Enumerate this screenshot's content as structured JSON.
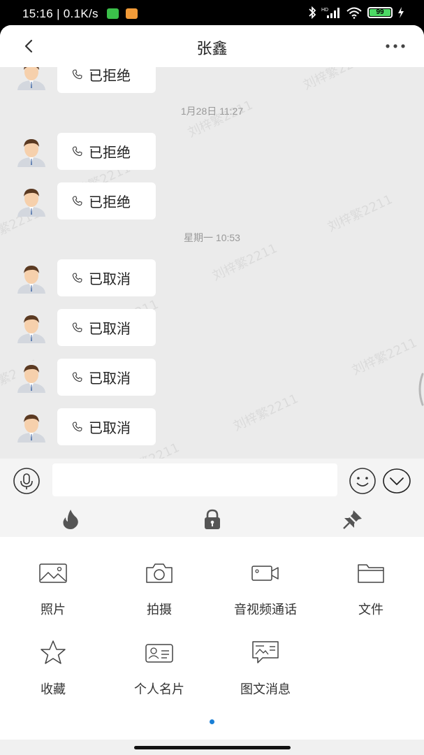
{
  "status_bar": {
    "time_speed": "15:16 | 0.1K/s",
    "battery": "99",
    "network": "HD"
  },
  "header": {
    "title": "张鑫"
  },
  "watermark": "刘梓繁2211",
  "messages": [
    {
      "text": "已拒绝"
    },
    {
      "timestamp": "1月28日 11:27"
    },
    {
      "text": "已拒绝"
    },
    {
      "text": "已拒绝"
    },
    {
      "timestamp": "星期一 10:53"
    },
    {
      "text": "已取消"
    },
    {
      "text": "已取消"
    },
    {
      "text": "已取消"
    },
    {
      "text": "已取消"
    }
  ],
  "input": {
    "value": "",
    "placeholder": ""
  },
  "tools": [
    "flame-icon",
    "lock-icon",
    "pin-off-icon"
  ],
  "panel": {
    "items": [
      {
        "label": "照片",
        "icon": "image-icon"
      },
      {
        "label": "拍摄",
        "icon": "camera-icon"
      },
      {
        "label": "音视频通话",
        "icon": "video-call-icon"
      },
      {
        "label": "文件",
        "icon": "folder-icon"
      },
      {
        "label": "收藏",
        "icon": "star-icon"
      },
      {
        "label": "个人名片",
        "icon": "contact-card-icon"
      },
      {
        "label": "图文消息",
        "icon": "rich-message-icon"
      }
    ]
  },
  "colors": {
    "chat_bg": "#ebebeb",
    "bubble_bg": "#ffffff",
    "accent": "#1a7fd6"
  }
}
